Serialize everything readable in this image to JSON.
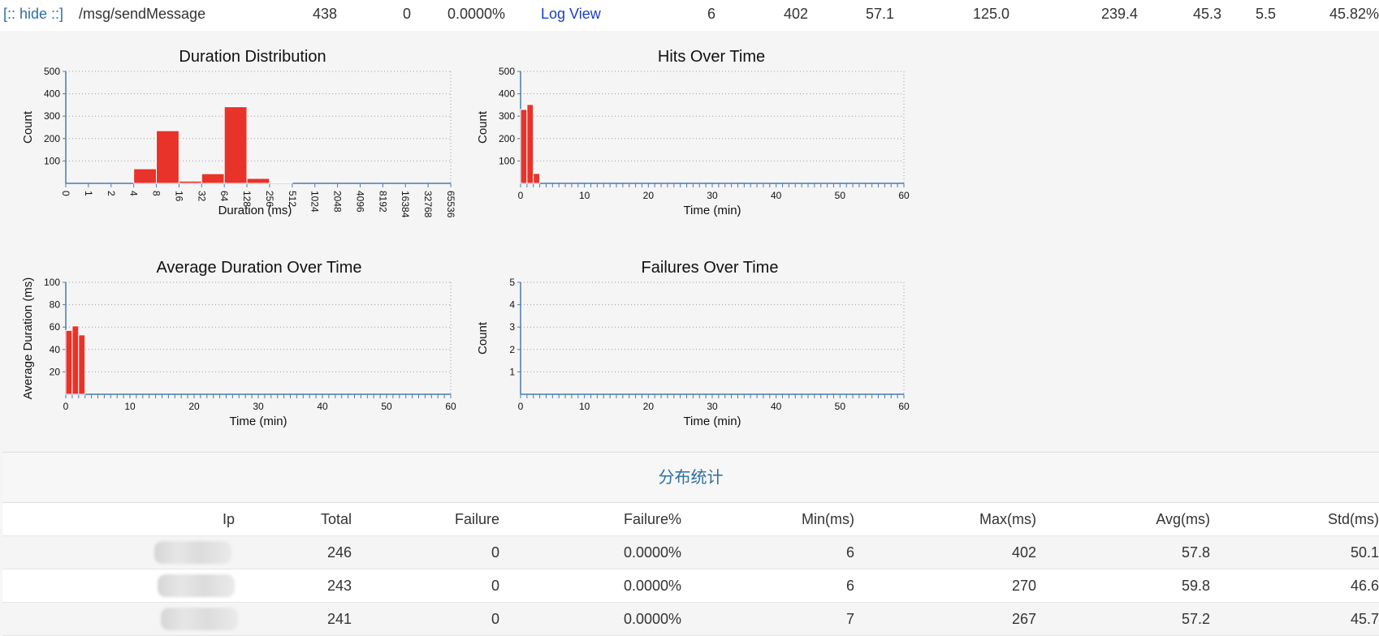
{
  "top_row": {
    "hide_link": "[:: hide ::]",
    "path": "/msg/sendMessage",
    "total": "438",
    "failure": "0",
    "failure_pct": "0.0000%",
    "log_view": "Log View",
    "min": "6",
    "max": "402",
    "avg": "57.1",
    "col9": "125.0",
    "col10": "239.4",
    "col11": "45.3",
    "col12": "5.5",
    "col13": "45.82%"
  },
  "colors": {
    "bar": "#e8332a",
    "axis": "#4a7ab5",
    "link": "#1a3fc4",
    "section_title": "#2c6fa6"
  },
  "chart_data": [
    {
      "type": "bar",
      "title": "Duration Distribution",
      "xlabel": "Duration (ms)",
      "ylabel": "Count",
      "ylim": [
        0,
        500
      ],
      "yticks": [
        "100",
        "200",
        "300",
        "400",
        "500"
      ],
      "categories": [
        "0",
        "1",
        "2",
        "4",
        "8",
        "16",
        "32",
        "64",
        "128",
        "256",
        "512",
        "1024",
        "2048",
        "4096",
        "8192",
        "16384",
        "32768",
        "65536"
      ],
      "values": [
        0,
        0,
        0,
        65,
        235,
        10,
        43,
        342,
        22,
        3,
        0,
        0,
        0,
        0,
        0,
        0,
        0
      ],
      "grid": true
    },
    {
      "type": "bar",
      "title": "Hits Over Time",
      "xlabel": "Time (min)",
      "ylabel": "Count",
      "ylim": [
        0,
        500
      ],
      "xlim": [
        0,
        60
      ],
      "yticks": [
        "100",
        "200",
        "300",
        "400",
        "500"
      ],
      "xticks": [
        "0",
        "10",
        "20",
        "30",
        "40",
        "50",
        "60"
      ],
      "x": [
        0,
        1,
        2
      ],
      "values": [
        330,
        352,
        44
      ],
      "grid": true
    },
    {
      "type": "bar",
      "title": "Average Duration Over Time",
      "xlabel": "Time (min)",
      "ylabel": "Average Duration (ms)",
      "ylim": [
        0,
        100
      ],
      "xlim": [
        0,
        60
      ],
      "yticks": [
        "20",
        "40",
        "60",
        "80",
        "100"
      ],
      "xticks": [
        "0",
        "10",
        "20",
        "30",
        "40",
        "50",
        "60"
      ],
      "x": [
        0,
        1,
        2
      ],
      "values": [
        57,
        61,
        53
      ],
      "grid": true
    },
    {
      "type": "bar",
      "title": "Failures Over Time",
      "xlabel": "Time (min)",
      "ylabel": "Count",
      "ylim": [
        0,
        5
      ],
      "xlim": [
        0,
        60
      ],
      "yticks": [
        "1",
        "2",
        "3",
        "4",
        "5"
      ],
      "xticks": [
        "0",
        "10",
        "20",
        "30",
        "40",
        "50",
        "60"
      ],
      "x": [],
      "values": [],
      "grid": true
    }
  ],
  "distribution": {
    "title": "分布统计",
    "headers": [
      "Ip",
      "Total",
      "Failure",
      "Failure%",
      "Min(ms)",
      "Max(ms)",
      "Avg(ms)",
      "Std(ms)"
    ],
    "rows": [
      {
        "total": "246",
        "failure": "0",
        "failure_pct": "0.0000%",
        "min": "6",
        "max": "402",
        "avg": "57.8",
        "std": "50.1"
      },
      {
        "total": "243",
        "failure": "0",
        "failure_pct": "0.0000%",
        "min": "6",
        "max": "270",
        "avg": "59.8",
        "std": "46.6"
      },
      {
        "total": "241",
        "failure": "0",
        "failure_pct": "0.0000%",
        "min": "7",
        "max": "267",
        "avg": "57.2",
        "std": "45.7"
      }
    ]
  }
}
